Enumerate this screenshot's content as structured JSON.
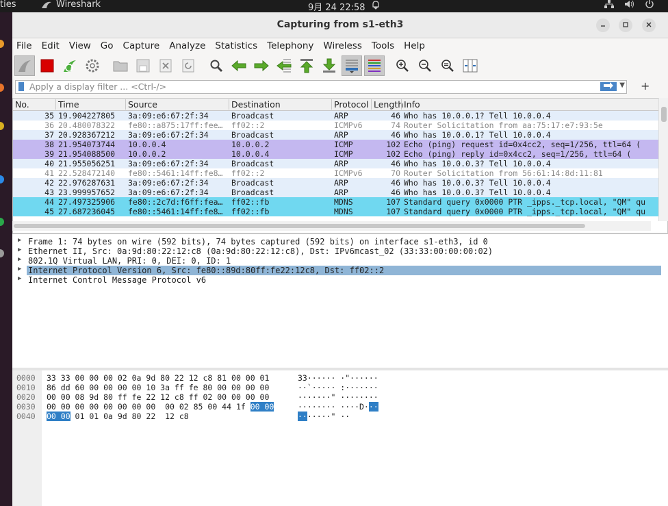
{
  "topbar": {
    "activities": "ties",
    "app_name": "Wireshark",
    "clock": "9月 24  22:58"
  },
  "window": {
    "title": "Capturing from s1-eth3"
  },
  "menu": [
    "File",
    "Edit",
    "View",
    "Go",
    "Capture",
    "Analyze",
    "Statistics",
    "Telephony",
    "Wireless",
    "Tools",
    "Help"
  ],
  "filter": {
    "placeholder": "Apply a display filter ... <Ctrl-/>",
    "plus": "+"
  },
  "columns": [
    "No.",
    "Time",
    "Source",
    "Destination",
    "Protocol",
    "Length",
    "Info"
  ],
  "packets": [
    {
      "no": "35",
      "time": "19.904227805",
      "src": "3a:09:e6:67:2f:34",
      "dst": "Broadcast",
      "proto": "ARP",
      "len": "46",
      "info": "Who has 10.0.0.1? Tell 10.0.0.4",
      "bg": "#e4eefa",
      "fg": "#222222"
    },
    {
      "no": "36",
      "time": "20.480078322",
      "src": "fe80::a875:17ff:fee…",
      "dst": "ff02::2",
      "proto": "ICMPv6",
      "len": "74",
      "info": "Router Solicitation from aa:75:17:e7:93:5e",
      "bg": "#ffffff",
      "fg": "#8a8a8a"
    },
    {
      "no": "37",
      "time": "20.928367212",
      "src": "3a:09:e6:67:2f:34",
      "dst": "Broadcast",
      "proto": "ARP",
      "len": "46",
      "info": "Who has 10.0.0.1? Tell 10.0.0.4",
      "bg": "#e4eefa",
      "fg": "#222222"
    },
    {
      "no": "38",
      "time": "21.954073744",
      "src": "10.0.0.4",
      "dst": "10.0.0.2",
      "proto": "ICMP",
      "len": "102",
      "info": "Echo (ping) request  id=0x4cc2, seq=1/256, ttl=64 (",
      "bg": "#c4b8f0",
      "fg": "#222222"
    },
    {
      "no": "39",
      "time": "21.954088500",
      "src": "10.0.0.2",
      "dst": "10.0.0.4",
      "proto": "ICMP",
      "len": "102",
      "info": "Echo (ping) reply    id=0x4cc2, seq=1/256, ttl=64 (",
      "bg": "#c4b8f0",
      "fg": "#222222"
    },
    {
      "no": "40",
      "time": "21.955056251",
      "src": "3a:09:e6:67:2f:34",
      "dst": "Broadcast",
      "proto": "ARP",
      "len": "46",
      "info": "Who has 10.0.0.3? Tell 10.0.0.4",
      "bg": "#e4eefa",
      "fg": "#222222"
    },
    {
      "no": "41",
      "time": "22.528472140",
      "src": "fe80::5461:14ff:fe8…",
      "dst": "ff02::2",
      "proto": "ICMPv6",
      "len": "70",
      "info": "Router Solicitation from 56:61:14:8d:11:81",
      "bg": "#ffffff",
      "fg": "#8a8a8a"
    },
    {
      "no": "42",
      "time": "22.976287631",
      "src": "3a:09:e6:67:2f:34",
      "dst": "Broadcast",
      "proto": "ARP",
      "len": "46",
      "info": "Who has 10.0.0.3? Tell 10.0.0.4",
      "bg": "#e4eefa",
      "fg": "#222222"
    },
    {
      "no": "43",
      "time": "23.999957652",
      "src": "3a:09:e6:67:2f:34",
      "dst": "Broadcast",
      "proto": "ARP",
      "len": "46",
      "info": "Who has 10.0.0.3? Tell 10.0.0.4",
      "bg": "#e4eefa",
      "fg": "#222222"
    },
    {
      "no": "44",
      "time": "27.497325906",
      "src": "fe80::2c7d:f6ff:fea…",
      "dst": "ff02::fb",
      "proto": "MDNS",
      "len": "107",
      "info": "Standard query 0x0000 PTR _ipps._tcp.local, \"QM\" qu",
      "bg": "#70d8f0",
      "fg": "#222222"
    },
    {
      "no": "45",
      "time": "27.687236045",
      "src": "fe80::5461:14ff:fe8…",
      "dst": "ff02::fb",
      "proto": "MDNS",
      "len": "107",
      "info": "Standard query 0x0000 PTR _ipps._tcp.local, \"QM\" qu",
      "bg": "#70d8f0",
      "fg": "#222222"
    }
  ],
  "details": [
    {
      "text": "Frame 1: 74 bytes on wire (592 bits), 74 bytes captured (592 bits) on interface s1-eth3, id 0",
      "selected": false
    },
    {
      "text": "Ethernet II, Src: 0a:9d:80:22:12:c8 (0a:9d:80:22:12:c8), Dst: IPv6mcast_02 (33:33:00:00:00:02)",
      "selected": false
    },
    {
      "text": "802.1Q Virtual LAN, PRI: 0, DEI: 0, ID: 1",
      "selected": false
    },
    {
      "text": "Internet Protocol Version 6, Src: fe80::89d:80ff:fe22:12c8, Dst: ff02::2",
      "selected": true
    },
    {
      "text": "Internet Control Message Protocol v6",
      "selected": false
    }
  ],
  "bytes": [
    {
      "offset": "0000",
      "hex": "33 33 00 00 00 02 0a 9d  80 22 12 c8 81 00 00 01",
      "ascii": "33······ ·\"······"
    },
    {
      "offset": "0010",
      "hex": "86 dd 60 00 00 00 00 10  3a ff fe 80 00 00 00 00",
      "ascii": "··`····· :·······"
    },
    {
      "offset": "0020",
      "hex": "00 00 08 9d 80 ff fe 22  12 c8 ff 02 00 00 00 00",
      "ascii": "·······\" ········"
    },
    {
      "offset": "0030",
      "hex": "00 00 00 00 00 00 00 00  00 02 85 00 44 1f ",
      "hex_hl": "00 00",
      "ascii": "········ ····D·",
      "ascii_hl": "··"
    },
    {
      "offset": "0040",
      "hex_hl_pre": "00 00",
      "hex": " 01 01 0a 9d 80 22  12 c8",
      "ascii_hl_pre": "··",
      "ascii": "·····\" ··"
    }
  ]
}
